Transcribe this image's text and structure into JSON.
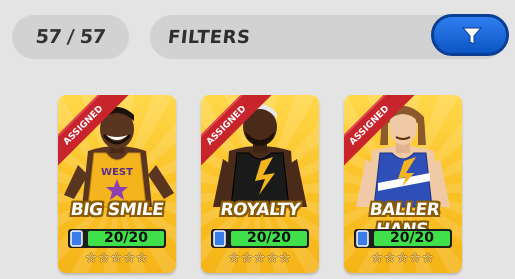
{
  "header": {
    "counter": "57 / 57",
    "filter_label": "FILTERS",
    "filter_button_icon": "filter-funnel-icon"
  },
  "cards": [
    {
      "ribbon": "ASSIGNED",
      "name": "BIG SMILE",
      "progress_text": "20/20",
      "progress_fraction": 1.0,
      "stars_filled": 0,
      "stars_total": 5,
      "jersey_text": "WEST",
      "jersey_color": "#f3b41e"
    },
    {
      "ribbon": "ASSIGNED",
      "name": "ROYALTY",
      "progress_text": "20/20",
      "progress_fraction": 1.0,
      "stars_filled": 0,
      "stars_total": 5,
      "jersey_color": "#1a1a1a"
    },
    {
      "ribbon": "ASSIGNED",
      "name": "BALLER HANS",
      "progress_text": "20/20",
      "progress_fraction": 1.0,
      "stars_filled": 0,
      "stars_total": 5,
      "jersey_color": "#2f4fb8"
    }
  ],
  "colors": {
    "background": "#e4e4e4",
    "card_gold": "#fbc42a",
    "ribbon_red": "#c8242c",
    "progress_green": "#3fe04a",
    "filter_button_blue": "#1e6fe0"
  }
}
